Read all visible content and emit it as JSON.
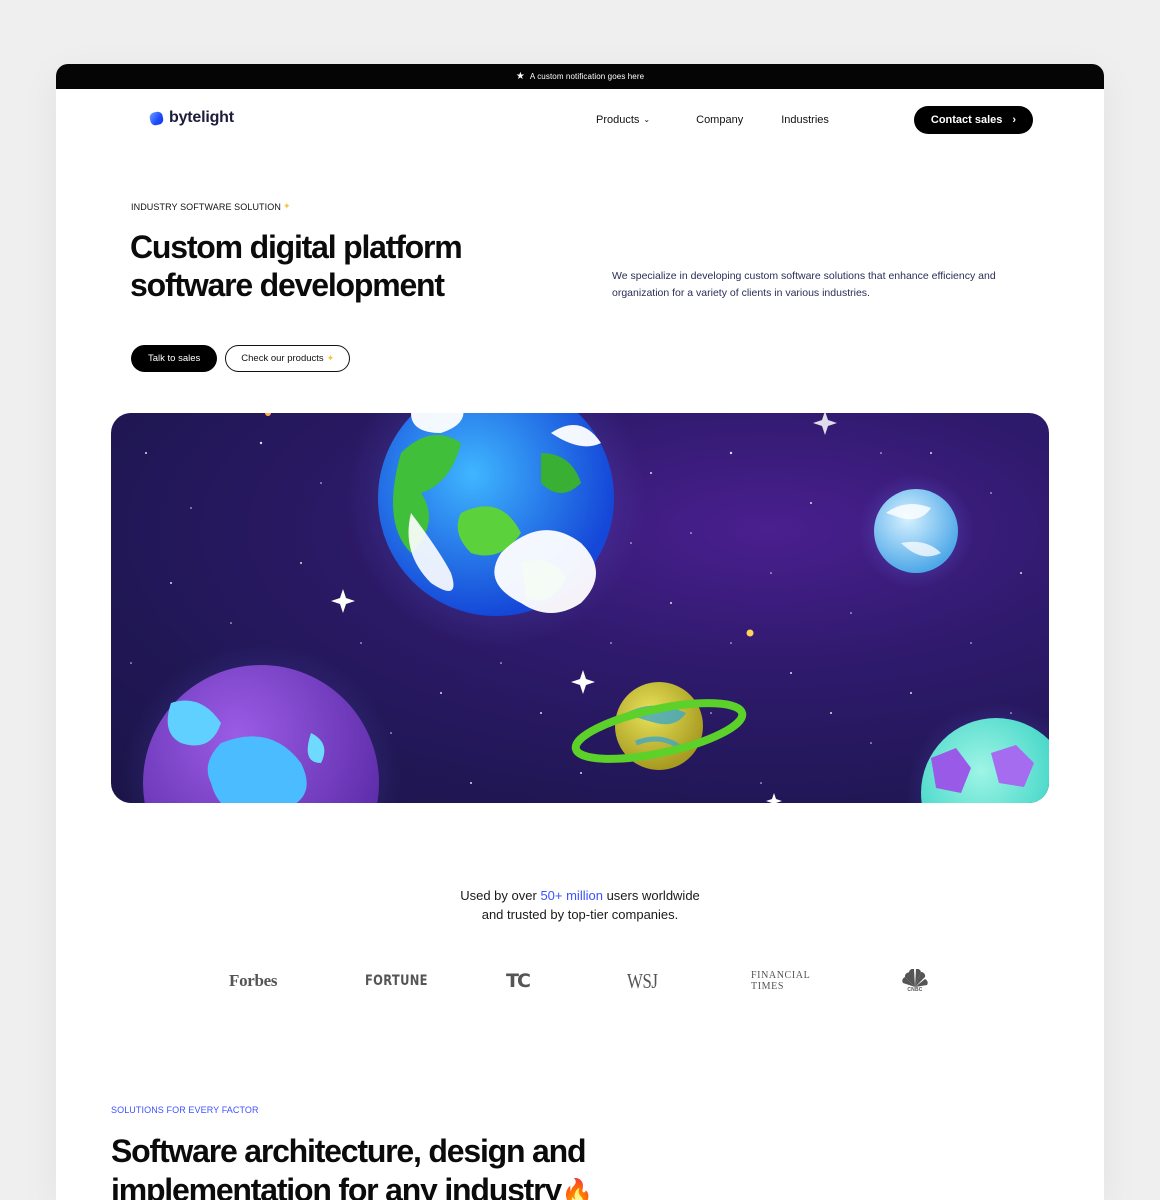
{
  "notification": {
    "icon": "star-icon",
    "text": "A custom notification goes here"
  },
  "brand": {
    "name": "bytelight",
    "accent": "#2b4fff"
  },
  "nav": {
    "items": [
      {
        "label": "Products",
        "has_dropdown": true
      },
      {
        "label": "Company"
      },
      {
        "label": "Industries"
      }
    ],
    "cta_label": "Contact sales"
  },
  "hero": {
    "eyebrow": "INDUSTRY SOFTWARE SOLUTION",
    "title": "Custom digital platform software development",
    "description": "We specialize in developing custom software solutions that enhance efficiency and organization for a variety of clients in various industries.",
    "primary_button": "Talk to sales",
    "secondary_button": "Check our products"
  },
  "trust": {
    "prefix": "Used by over",
    "highlight": "50+ million",
    "suffix": "users worldwide",
    "line2": "and trusted by top-tier companies.",
    "highlight_color": "#3b52ff",
    "logos": {
      "forbes": "Forbes",
      "fortune": "FORTUNE",
      "techcrunch": "TC",
      "wsj": "WSJ",
      "ft_line1": "FINANCIAL",
      "ft_line2": "TIMES",
      "cnbc": "CNBC"
    }
  },
  "solutions": {
    "eyebrow": "SOLUTIONS FOR EVERY FACTOR",
    "title": "Software architecture, design and implementation for any industry",
    "emoji": "🔥"
  }
}
